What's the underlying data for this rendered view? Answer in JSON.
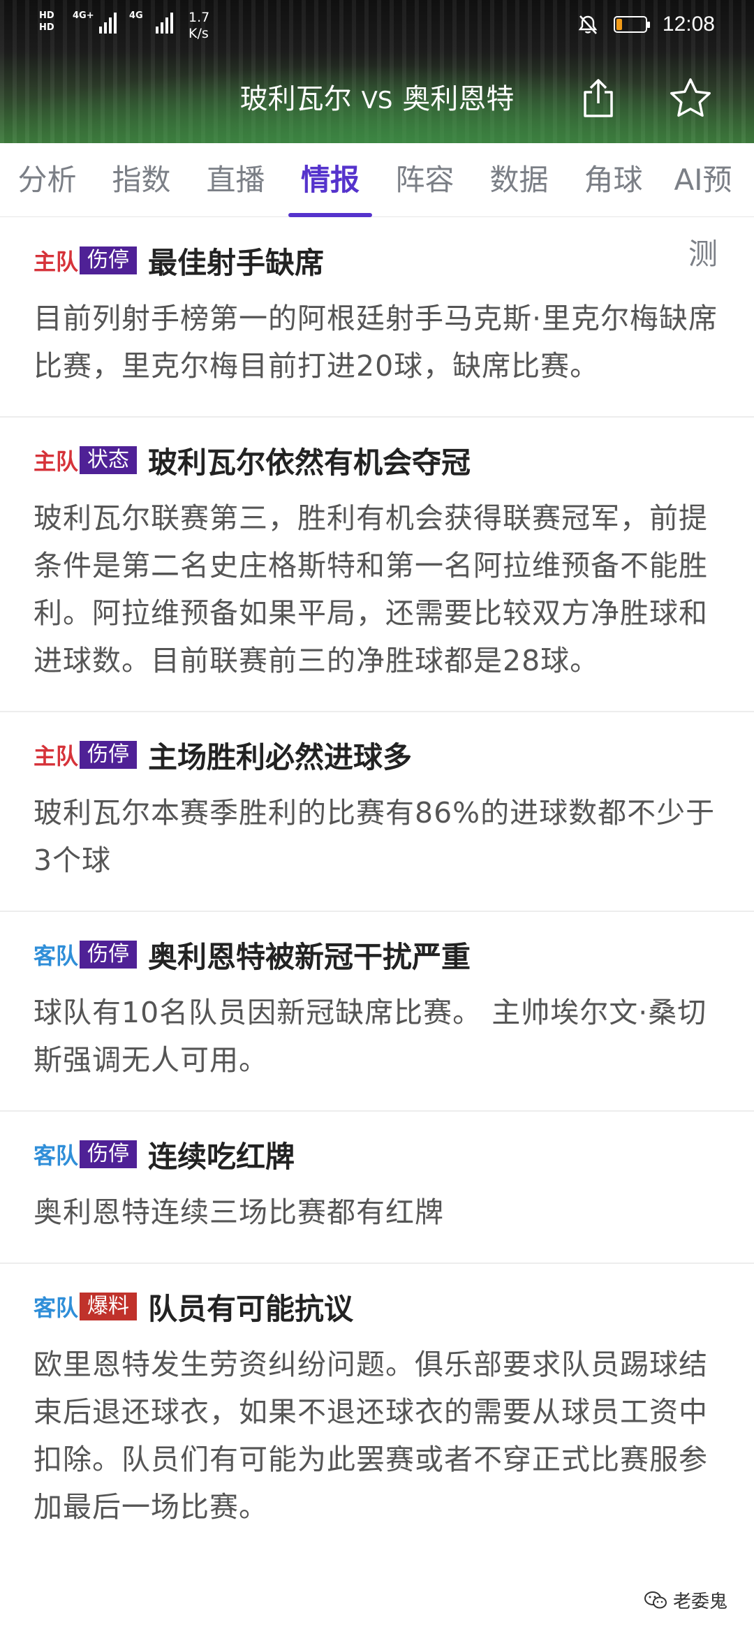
{
  "status_bar": {
    "hd1": "HD",
    "hd2": "HD",
    "net1": "4G+",
    "net2": "4G",
    "speed_value": "1.7",
    "speed_unit": "K/s",
    "battery_level": 0.2,
    "battery_color": "#f29b18",
    "time": "12:08"
  },
  "header": {
    "home_team": "玻利瓦尔",
    "vs": "VS",
    "away_team": "奥利恩特",
    "share_icon": "share-icon",
    "favorite_icon": "star-icon"
  },
  "tabs": [
    {
      "label": "分析",
      "active": false
    },
    {
      "label": "指数",
      "active": false
    },
    {
      "label": "直播",
      "active": false
    },
    {
      "label": "情报",
      "active": true
    },
    {
      "label": "阵容",
      "active": false
    },
    {
      "label": "数据",
      "active": false
    },
    {
      "label": "角球",
      "active": false
    },
    {
      "label": "AI预测",
      "active": false
    }
  ],
  "items": [
    {
      "team": "主队",
      "tag": "伤停",
      "title": "最佳射手缺席",
      "body": "目前列射手榜第一的阿根廷射手马克斯·里克尔梅缺席比赛，里克尔梅目前打进20球，缺席比赛。"
    },
    {
      "team": "主队",
      "tag": "状态",
      "title": "玻利瓦尔依然有机会夺冠",
      "body": "玻利瓦尔联赛第三，胜利有机会获得联赛冠军，前提条件是第二名史庄格斯特和第一名阿拉维预备不能胜利。阿拉维预备如果平局，还需要比较双方净胜球和进球数。目前联赛前三的净胜球都是28球。"
    },
    {
      "team": "主队",
      "tag": "伤停",
      "title": "主场胜利必然进球多",
      "body": "玻利瓦尔本赛季胜利的比赛有86%的进球数都不少于3个球"
    },
    {
      "team": "客队",
      "tag": "伤停",
      "title": "奥利恩特被新冠干扰严重",
      "body": "球队有10名队员因新冠缺席比赛。 主帅埃尔文·桑切斯强调无人可用。"
    },
    {
      "team": "客队",
      "tag": "伤停",
      "title": "连续吃红牌",
      "body": "奥利恩特连续三场比赛都有红牌"
    },
    {
      "team": "客队",
      "tag": "爆料",
      "title": "队员有可能抗议",
      "body": "欧里恩特发生劳资纠纷问题。俱乐部要求队员踢球结束后退还球衣，如果不退还球衣的需要从球员工资中扣除。队员们有可能为此罢赛或者不穿正式比赛服参加最后一场比赛。"
    }
  ],
  "watermark": "老委鬼",
  "colors": {
    "accent": "#5533cc",
    "home": "#d6333a",
    "away": "#2f8ed8",
    "tag_purple": "#4f2196",
    "tag_red": "#c0322b"
  }
}
